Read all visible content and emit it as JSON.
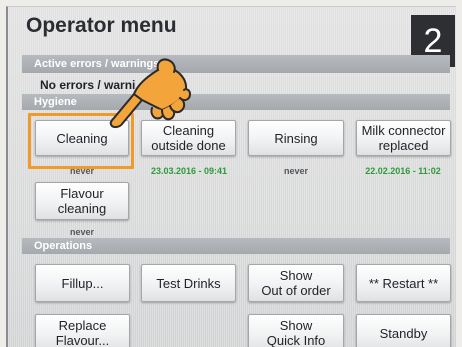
{
  "screen": {
    "title": "Operator menu",
    "step_number": "2"
  },
  "errors_section": {
    "header": "Active errors / warnings",
    "status": "No errors / warni"
  },
  "hygiene": {
    "header": "Hygiene",
    "buttons": [
      {
        "label": "Cleaning",
        "sub_label": "never",
        "sub_color": "gray"
      },
      {
        "label": "Cleaning\noutside done",
        "sub_label": "23.03.2016 - 09:41",
        "sub_color": "green"
      },
      {
        "label": "Rinsing",
        "sub_label": "never",
        "sub_color": "gray"
      },
      {
        "label": "Milk connector\nreplaced",
        "sub_label": "22.02.2016 - 11:02",
        "sub_color": "green"
      },
      {
        "label": "Flavour\ncleaning",
        "sub_label": "never",
        "sub_color": "gray"
      }
    ],
    "highlighted_button": "Cleaning"
  },
  "operations": {
    "header": "Operations",
    "buttons": [
      {
        "label": "Fillup..."
      },
      {
        "label": "Test Drinks"
      },
      {
        "label": "Show\nOut of order"
      },
      {
        "label": "** Restart **"
      },
      {
        "label": "Replace\nFlavour..."
      },
      {
        "label": "Show\nQuick Info"
      },
      {
        "label": "Standby"
      }
    ]
  },
  "colors": {
    "highlight": "#f09a2c",
    "timestamp_green": "#2f9a3a",
    "section_bar": "#a9adb2",
    "badge": "#2d2f33"
  },
  "icons": {
    "pointer": "pointing-hand-icon"
  }
}
